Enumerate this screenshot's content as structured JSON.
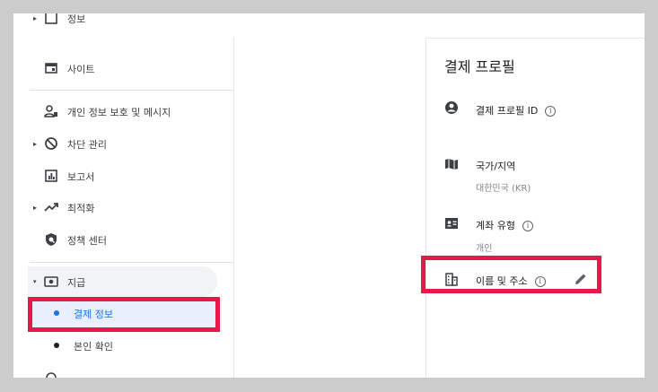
{
  "sidebar": {
    "top_partial_label": "정보",
    "items": [
      {
        "label": "사이트",
        "icon": "site-icon"
      },
      {
        "label": "개인 정보 보호 및 메시지",
        "icon": "privacy-icon"
      },
      {
        "label": "차단 관리",
        "icon": "block-icon"
      },
      {
        "label": "보고서",
        "icon": "report-icon"
      },
      {
        "label": "최적화",
        "icon": "trending-icon"
      },
      {
        "label": "정책 센터",
        "icon": "shield-icon"
      },
      {
        "label": "지급",
        "icon": "payments-icon"
      }
    ],
    "sub_items": [
      {
        "label": "결제 정보",
        "selected": true
      },
      {
        "label": "본인 확인",
        "selected": false
      }
    ]
  },
  "card": {
    "title": "결제 프로필",
    "rows": [
      {
        "label": "결제 프로필 ID",
        "value": "",
        "icon": "account-circle-icon",
        "has_info": true
      },
      {
        "label": "국가/지역",
        "value": "대한민국 (KR)",
        "icon": "map-icon",
        "has_info": false
      },
      {
        "label": "계좌 유형",
        "value": "개인",
        "icon": "contact-card-icon",
        "has_info": true
      },
      {
        "label": "이름 및 주소",
        "value": "",
        "icon": "building-icon",
        "has_info": true,
        "editable": true
      }
    ],
    "info_glyph": "i"
  },
  "colors": {
    "highlight": "#e8184b",
    "accent": "#1a73e8",
    "selected_bg": "#e8f0fe"
  }
}
